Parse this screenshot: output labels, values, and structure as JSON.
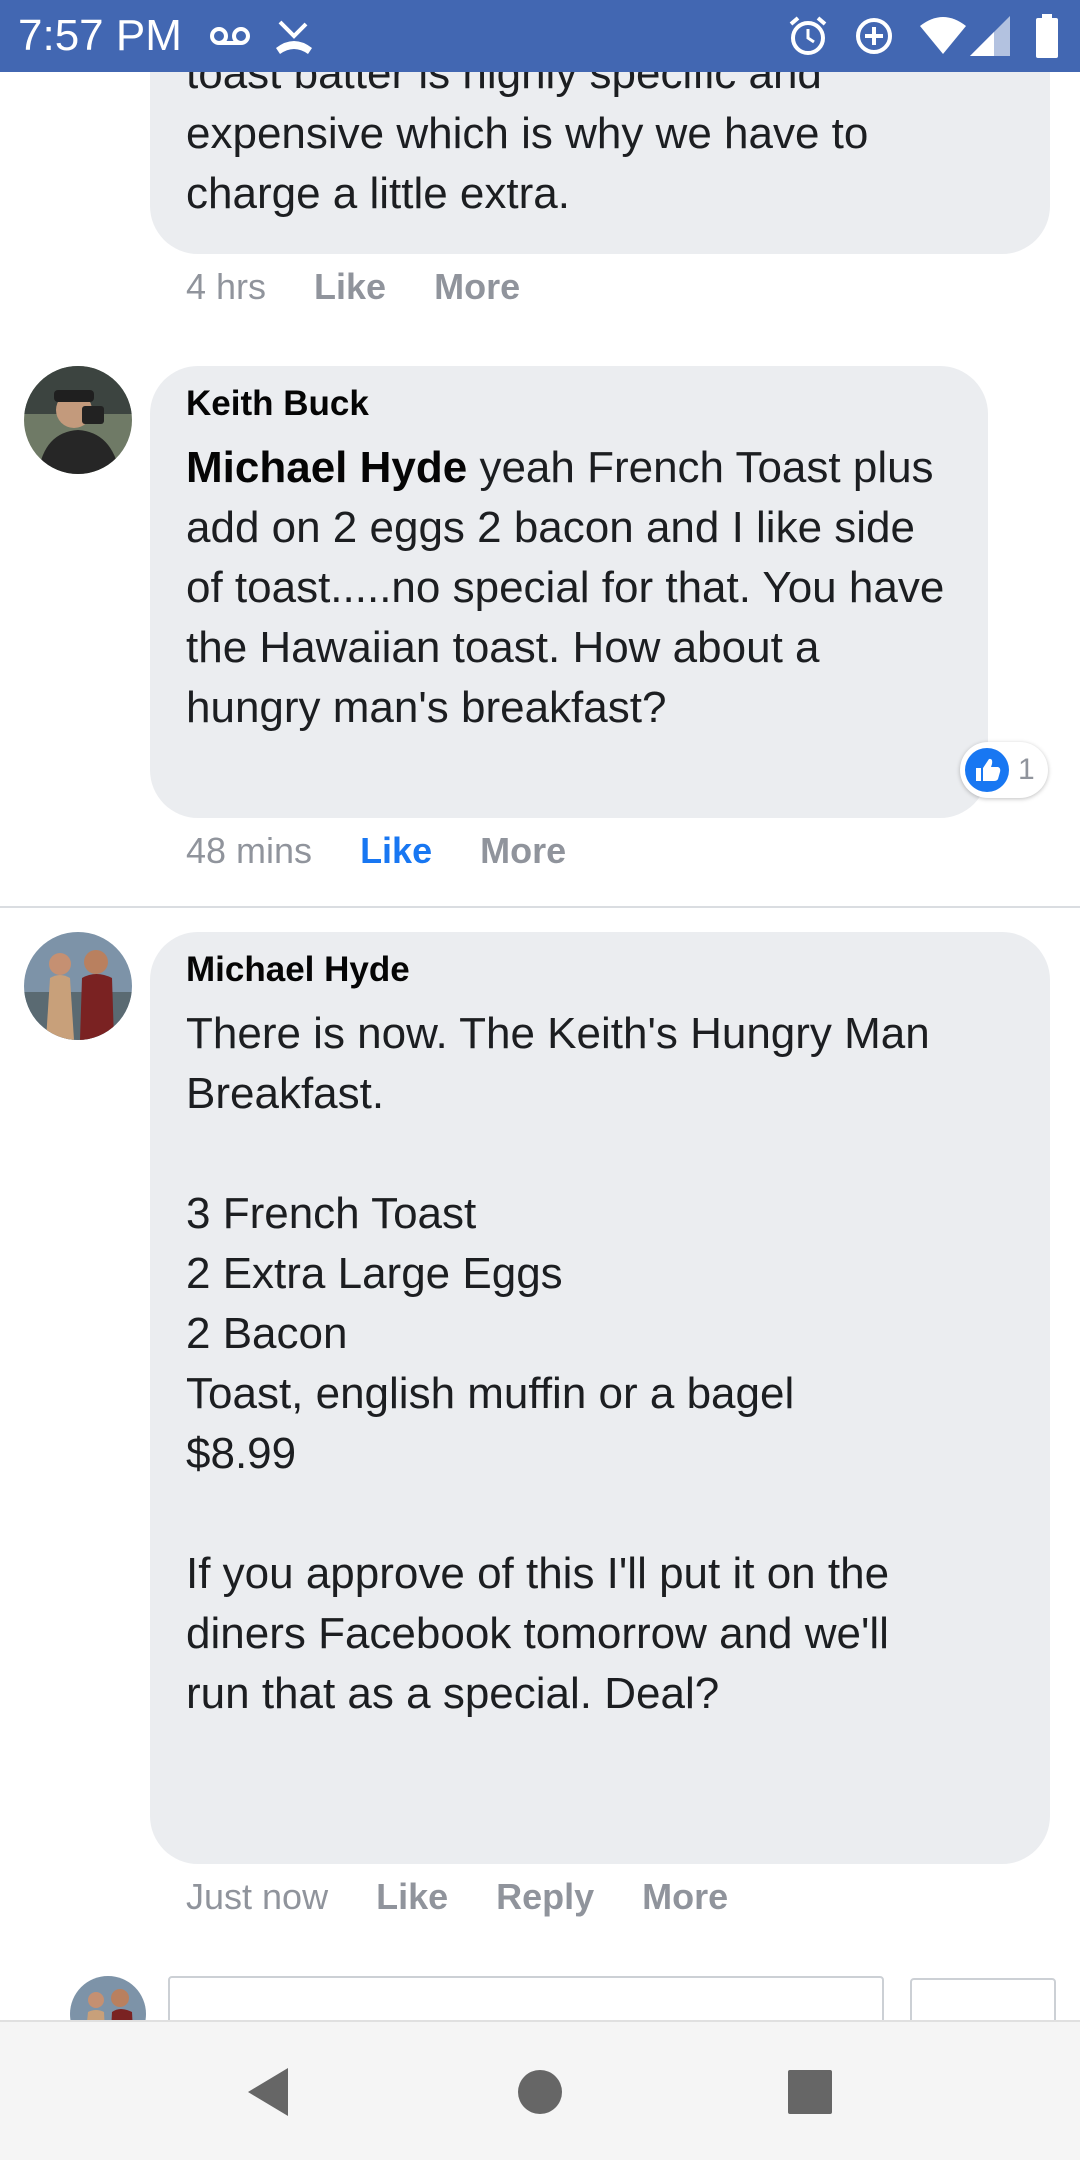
{
  "status_bar": {
    "time": "7:57 PM",
    "icons": [
      "voicemail-icon",
      "missed-call-icon",
      "alarm-icon",
      "data-saver-icon",
      "wifi-icon",
      "signal-icon",
      "battery-icon"
    ]
  },
  "comments": [
    {
      "partial_text": "toast batter is highly specific and\nexpensive which is why we have to\ncharge a little extra.",
      "time": "4 hrs",
      "like_label": "Like",
      "more_label": "More"
    },
    {
      "author": "Keith Buck",
      "mention": "Michael Hyde",
      "text": " yeah French Toast plus add on 2 eggs 2 bacon and I like side of toast.....no special for that. You have the Hawaiian toast. How about a hungry man's breakfast?",
      "time": "48 mins",
      "like_label": "Like",
      "more_label": "More",
      "reaction_count": "1"
    },
    {
      "author": "Michael Hyde",
      "text": "There is now. The Keith's Hungry Man\nBreakfast.\n\n3 French Toast\n2 Extra Large Eggs\n2 Bacon\nToast, english muffin or a bagel\n$8.99\n\nIf you approve of this I'll put it on the\ndiners Facebook tomorrow and we'll\nrun that as a special. Deal?",
      "time": "Just now",
      "like_label": "Like",
      "reply_label": "Reply",
      "more_label": "More"
    }
  ],
  "colors": {
    "status_bar": "#4267b2",
    "bubble": "#ebedf0",
    "liked": "#1877f2",
    "meta": "#90949c"
  }
}
